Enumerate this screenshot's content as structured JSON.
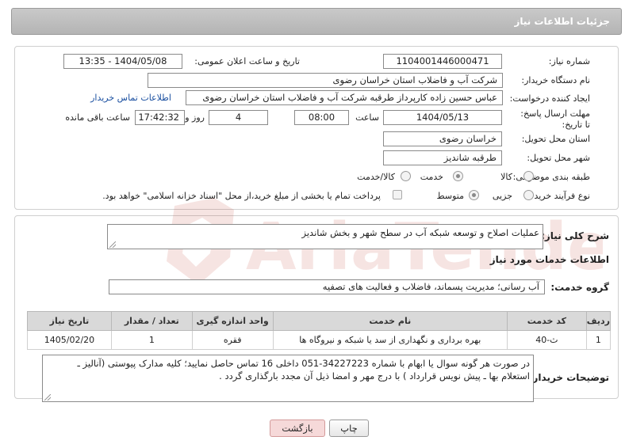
{
  "header": {
    "title": "جزئیات اطلاعات نیاز"
  },
  "need": {
    "number_label": "شماره نیاز:",
    "number": "1104001446000471",
    "announce_label": "تاریخ و ساعت اعلان عمومی:",
    "announce": "1404/05/08 - 13:35",
    "buyer_label": "نام دستگاه خریدار:",
    "buyer": "شرکت آب و فاضلاب استان خراسان رضوی",
    "creator_label": "ایجاد کننده درخواست:",
    "creator": "عباس حسین زاده کارپرداز طرقبه  شرکت آب و فاضلاب استان خراسان رضوی",
    "contact_link": "اطلاعات تماس خریدار",
    "deadline_label": "مهلت ارسال پاسخ: تا تاریخ:",
    "deadline_date": "1404/05/13",
    "time_label": "ساعت",
    "deadline_time": "08:00",
    "days": "4",
    "days_label": "روز و",
    "remaining": "17:42:32",
    "remaining_label": "ساعت باقی مانده",
    "province_label": "استان محل تحویل:",
    "province": "خراسان رضوی",
    "city_label": "شهر محل تحویل:",
    "city": "طرقبه شاندیز",
    "category_label": "طبقه بندی موضوعی:",
    "category_options": [
      "کالا",
      "خدمت",
      "کالا/خدمت"
    ],
    "category_selected": "خدمت",
    "process_label": "نوع فرآیند خرید :",
    "process_options": [
      "جزیی",
      "متوسط"
    ],
    "process_selected": "متوسط",
    "treasury_note": "پرداخت تمام یا بخشی از مبلغ خرید،از محل \"اسناد خزانه اسلامی\" خواهد بود."
  },
  "summary": {
    "label": "شرح کلی نیاز:",
    "text": "عملیات اصلاح و توسعه شبکه آب در سطح شهر و بخش شاندیز"
  },
  "services": {
    "section_title": "اطلاعات خدمات مورد نیاز",
    "group_label": "گروه خدمت:",
    "group": "آب رسانی؛ مدیریت پسماند، فاضلاب و فعالیت های تصفیه",
    "columns": [
      "ردیف",
      "کد خدمت",
      "نام خدمت",
      "واحد اندازه گیری",
      "تعداد / مقدار",
      "تاریخ نیاز"
    ],
    "rows": [
      [
        "1",
        "ث-40",
        "بهره برداری و نگهداری از سد یا شبکه و نیروگاه ها",
        "فقره",
        "1",
        "1405/02/20"
      ]
    ]
  },
  "buyer_notes": {
    "label": "توضیحات خریدار:",
    "line1": "در صورت هر گونه سوال یا ابهام با شماره 34227223-051 داخلی 16   تماس حاصل نمایید؛ کلیه مدارک پیوستی (آنالیز ـ",
    "line2": "استعلام بها ـ پیش نویس قرارداد ) با درج مهر و امضا ذیل آن مجدد بارگذاری گردد ."
  },
  "buttons": {
    "print": "چاپ",
    "back": "بازگشت"
  },
  "watermark": {
    "text": "AriaTender.neT"
  }
}
